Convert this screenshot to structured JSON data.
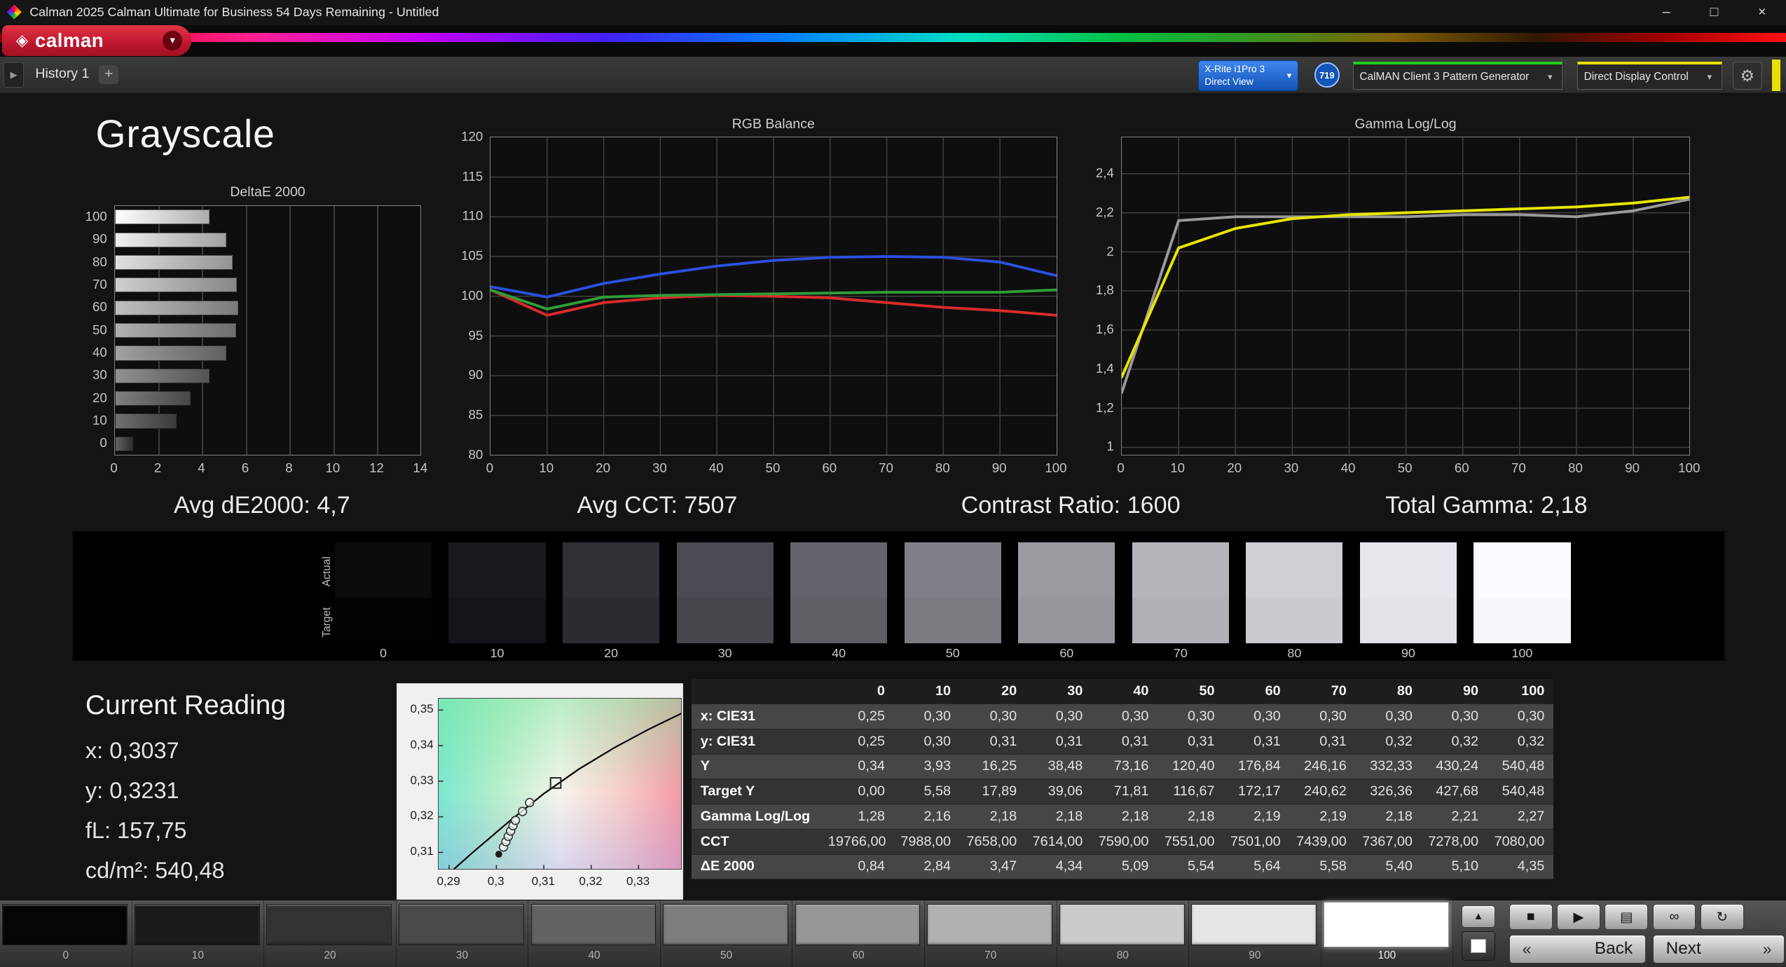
{
  "titlebar": {
    "title": "Calman 2025 Calman Ultimate for Business 54 Days Remaining  - Untitled"
  },
  "glyphs": {
    "minimize": "–",
    "maximize": "□",
    "close": "×",
    "dropdown": "▾",
    "gear": "⚙",
    "logo_diamond": "◈",
    "nav_arrow": "▶",
    "plus": "+",
    "up": "▲",
    "back_chev": "«",
    "next_chev": "»"
  },
  "brand": {
    "logo_text": "calman"
  },
  "tabbar": {
    "history_tab": "History 1",
    "meter": {
      "line1": "X-Rite i1Pro 3",
      "line2": "Direct View",
      "badge": "719"
    },
    "pattern_source": "CalMAN Client 3 Pattern Generator",
    "display_control": "Direct Display Control"
  },
  "colors": {
    "meter_blue": "#1254b8",
    "meter_blue_light": "#3f86ee",
    "source_green": "#22cc22",
    "display_yellow": "#e8e000",
    "logo_red": "#c01830"
  },
  "page_title": "Grayscale",
  "stats": {
    "avg_de": "Avg dE2000: 4,7",
    "avg_cct": "Avg CCT: 7507",
    "contrast": "Contrast Ratio: 1600",
    "gamma": "Total Gamma: 2,18"
  },
  "chart_data": [
    {
      "type": "bar",
      "title": "DeltaE 2000",
      "orientation": "horizontal",
      "categories": [
        100,
        90,
        80,
        70,
        60,
        50,
        40,
        30,
        20,
        10,
        0
      ],
      "values": [
        4.35,
        5.1,
        5.4,
        5.58,
        5.64,
        5.54,
        5.09,
        4.34,
        3.47,
        2.84,
        0.84
      ],
      "xlim": [
        0,
        14
      ],
      "xticks": [
        0,
        2,
        4,
        6,
        8,
        10,
        12,
        14
      ],
      "grid": true
    },
    {
      "type": "line",
      "title": "RGB Balance",
      "x": [
        0,
        10,
        20,
        30,
        40,
        50,
        60,
        70,
        80,
        90,
        100
      ],
      "ylim": [
        80,
        120
      ],
      "yticks": [
        80,
        85,
        90,
        95,
        100,
        105,
        110,
        115,
        120
      ],
      "grid": true,
      "series": [
        {
          "name": "red",
          "color": "#d92b2b",
          "values": [
            100.8,
            97.6,
            99.2,
            99.8,
            100.1,
            100.0,
            99.8,
            99.2,
            98.6,
            98.2,
            97.6
          ]
        },
        {
          "name": "green",
          "color": "#2e9e38",
          "values": [
            100.8,
            98.4,
            99.9,
            100.1,
            100.2,
            100.3,
            100.4,
            100.5,
            100.5,
            100.5,
            100.8
          ]
        },
        {
          "name": "blue",
          "color": "#2b50e0",
          "values": [
            101.2,
            99.9,
            101.6,
            102.8,
            103.8,
            104.5,
            104.9,
            105.0,
            104.9,
            104.3,
            102.6
          ]
        }
      ]
    },
    {
      "type": "line",
      "title": "Gamma Log/Log",
      "x": [
        0,
        10,
        20,
        30,
        40,
        50,
        60,
        70,
        80,
        90,
        100
      ],
      "ylim": [
        0.96,
        2.586
      ],
      "yticks": [
        1,
        1.2,
        1.4,
        1.6,
        1.8,
        2,
        2.2,
        2.4
      ],
      "ytick_labels": [
        "1",
        "1,2",
        "1,4",
        "1,6",
        "1,8",
        "2",
        "2,2",
        "2,4"
      ],
      "grid": true,
      "series": [
        {
          "name": "reference",
          "color": "#9a9a9a",
          "values": [
            1.28,
            2.16,
            2.18,
            2.18,
            2.18,
            2.18,
            2.19,
            2.19,
            2.18,
            2.21,
            2.27
          ]
        },
        {
          "name": "measured",
          "color": "#e6e600",
          "values": [
            1.36,
            2.02,
            2.12,
            2.17,
            2.19,
            2.2,
            2.21,
            2.22,
            2.23,
            2.25,
            2.28
          ]
        }
      ]
    }
  ],
  "swatches": {
    "row_labels": [
      "Actual",
      "Target"
    ],
    "levels": [
      {
        "label": "0",
        "actual": "#0b0b0e",
        "target": "#020204"
      },
      {
        "label": "10",
        "actual": "#18181d",
        "target": "#131318"
      },
      {
        "label": "20",
        "actual": "#303037",
        "target": "#2b2b31"
      },
      {
        "label": "30",
        "actual": "#4a4a52",
        "target": "#45454c"
      },
      {
        "label": "40",
        "actual": "#64646c",
        "target": "#5f5f66"
      },
      {
        "label": "50",
        "actual": "#7f7f87",
        "target": "#7a7a81"
      },
      {
        "label": "60",
        "actual": "#9a9aa1",
        "target": "#95959b"
      },
      {
        "label": "70",
        "actual": "#b5b5bc",
        "target": "#b0b0b6"
      },
      {
        "label": "80",
        "actual": "#cfcfd6",
        "target": "#cacad0"
      },
      {
        "label": "90",
        "actual": "#e7e7ee",
        "target": "#e2e2e8"
      },
      {
        "label": "100",
        "actual": "#fbfbff",
        "target": "#f7f7fd"
      }
    ]
  },
  "current_reading": {
    "title": "Current Reading",
    "lines": [
      "x: 0,3037",
      "y: 0,3231",
      "fL: 157,75",
      "cd/m²: 540,48"
    ]
  },
  "cie_chart": {
    "xticks": {
      "labels": [
        "0,29",
        "0,3",
        "0,31",
        "0,32",
        "0,33"
      ],
      "values": [
        0.29,
        0.3,
        0.31,
        0.32,
        0.33
      ]
    },
    "yticks": {
      "labels": [
        "0,35",
        "0,34",
        "0,33",
        "0,32",
        "0,31"
      ],
      "values": [
        0.35,
        0.34,
        0.33,
        0.32,
        0.31
      ]
    },
    "xrange": [
      0.2878,
      0.339
    ],
    "yrange": [
      0.3052,
      0.3532
    ],
    "locus": [
      [
        0.2878,
        0.3015
      ],
      [
        0.295,
        0.31
      ],
      [
        0.3025,
        0.3185
      ],
      [
        0.31,
        0.3265
      ],
      [
        0.3175,
        0.3335
      ],
      [
        0.325,
        0.3395
      ],
      [
        0.332,
        0.3445
      ],
      [
        0.339,
        0.349
      ]
    ],
    "points": [
      [
        0.3015,
        0.3115
      ],
      [
        0.302,
        0.313
      ],
      [
        0.3025,
        0.3145
      ],
      [
        0.303,
        0.316
      ],
      [
        0.3035,
        0.3175
      ],
      [
        0.304,
        0.319
      ],
      [
        0.3055,
        0.3215
      ],
      [
        0.307,
        0.324
      ]
    ],
    "dot": [
      0.3005,
      0.3095
    ],
    "square": [
      0.3125,
      0.3295
    ]
  },
  "table": {
    "col_headers": [
      "0",
      "10",
      "20",
      "30",
      "40",
      "50",
      "60",
      "70",
      "80",
      "90",
      "100"
    ],
    "rows": [
      {
        "label": "x: CIE31",
        "values": [
          "0,25",
          "0,30",
          "0,30",
          "0,30",
          "0,30",
          "0,30",
          "0,30",
          "0,30",
          "0,30",
          "0,30",
          "0,30"
        ]
      },
      {
        "label": "y: CIE31",
        "values": [
          "0,25",
          "0,30",
          "0,31",
          "0,31",
          "0,31",
          "0,31",
          "0,31",
          "0,31",
          "0,32",
          "0,32",
          "0,32"
        ]
      },
      {
        "label": "Y",
        "values": [
          "0,34",
          "3,93",
          "16,25",
          "38,48",
          "73,16",
          "120,40",
          "176,84",
          "246,16",
          "332,33",
          "430,24",
          "540,48"
        ]
      },
      {
        "label": "Target Y",
        "values": [
          "0,00",
          "5,58",
          "17,89",
          "39,06",
          "71,81",
          "116,67",
          "172,17",
          "240,62",
          "326,36",
          "427,68",
          "540,48"
        ]
      },
      {
        "label": "Gamma Log/Log",
        "values": [
          "1,28",
          "2,16",
          "2,18",
          "2,18",
          "2,18",
          "2,18",
          "2,19",
          "2,19",
          "2,18",
          "2,21",
          "2,27"
        ]
      },
      {
        "label": "CCT",
        "values": [
          "19766,00",
          "7988,00",
          "7658,00",
          "7614,00",
          "7590,00",
          "7551,00",
          "7501,00",
          "7439,00",
          "7367,00",
          "7278,00",
          "7080,00"
        ]
      },
      {
        "label": "ΔE 2000",
        "values": [
          "0,84",
          "2,84",
          "3,47",
          "4,34",
          "5,09",
          "5,54",
          "5,64",
          "5,58",
          "5,40",
          "5,10",
          "4,35"
        ]
      }
    ]
  },
  "bottom": {
    "patterns": [
      {
        "label": "0",
        "color": "#050505"
      },
      {
        "label": "10",
        "color": "#1b1b1b"
      },
      {
        "label": "20",
        "color": "#323232"
      },
      {
        "label": "30",
        "color": "#4a4a4a"
      },
      {
        "label": "40",
        "color": "#636363"
      },
      {
        "label": "50",
        "color": "#7d7d7d"
      },
      {
        "label": "60",
        "color": "#979797"
      },
      {
        "label": "70",
        "color": "#b1b1b1"
      },
      {
        "label": "80",
        "color": "#cbcbcb"
      },
      {
        "label": "90",
        "color": "#e5e5e5"
      },
      {
        "label": "100",
        "color": "#ffffff",
        "selected": true
      }
    ],
    "icons": [
      {
        "name": "stop",
        "glyph": "■"
      },
      {
        "name": "play",
        "glyph": "▶"
      },
      {
        "name": "save",
        "glyph": "▤"
      },
      {
        "name": "loop",
        "glyph": "∞"
      },
      {
        "name": "refresh",
        "glyph": "↻"
      }
    ],
    "back": "Back",
    "next": "Next"
  }
}
